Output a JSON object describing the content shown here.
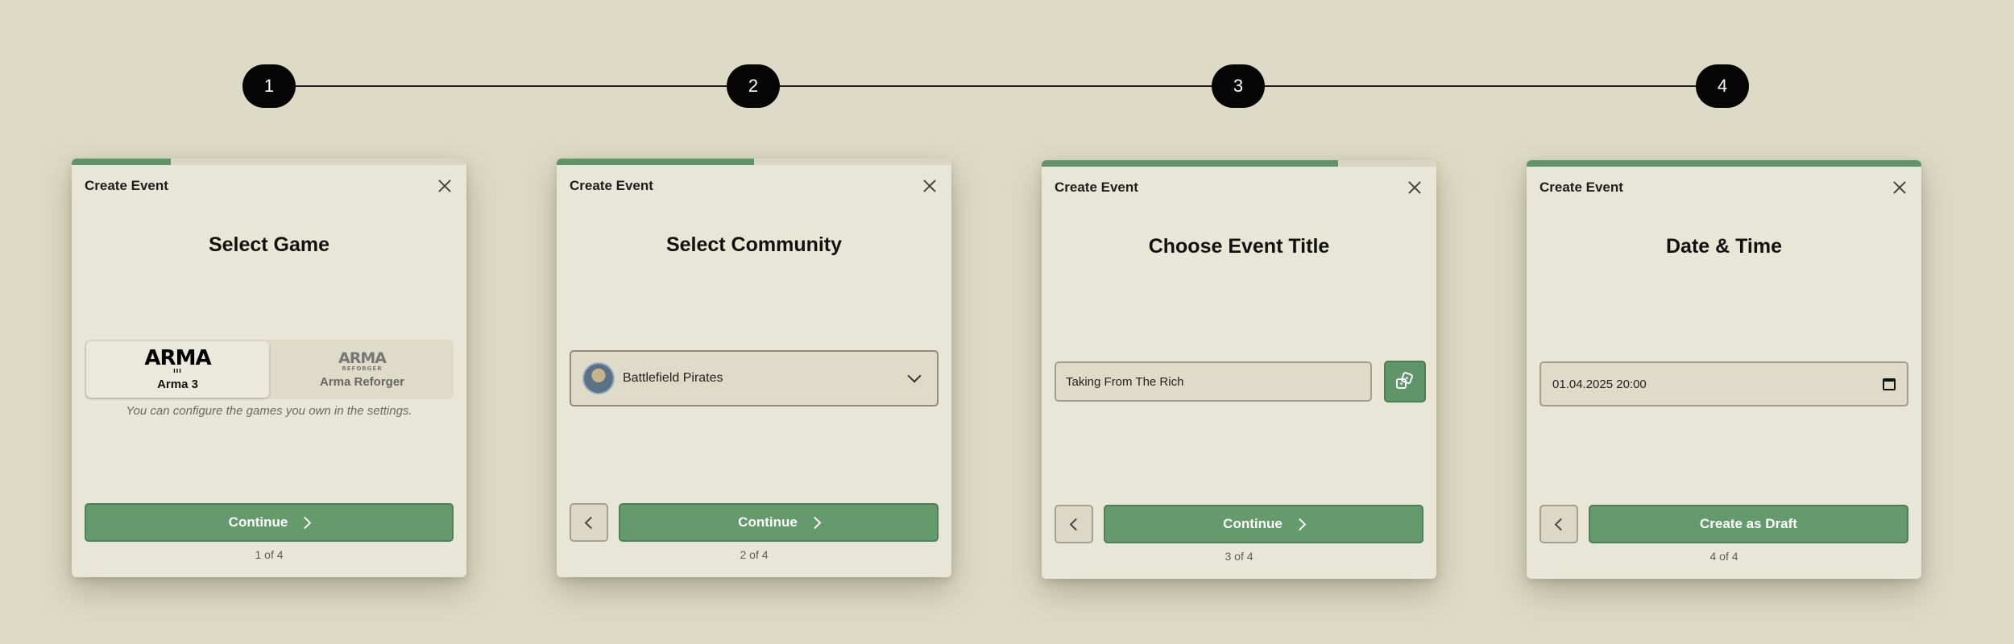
{
  "stepper": {
    "steps": [
      "1",
      "2",
      "3",
      "4"
    ]
  },
  "dialogs": [
    {
      "title": "Create Event",
      "progress": 0.25,
      "heading": "Select Game",
      "games": [
        {
          "logo": "ARMA",
          "logo_sub": "III",
          "label": "Arma 3",
          "selected": true
        },
        {
          "logo": "ARMA",
          "logo_sub": "REFORGER",
          "label": "Arma Reforger",
          "selected": false
        }
      ],
      "hint": "You can configure the games you own in the settings.",
      "continue_label": "Continue",
      "step_count": "1 of 4"
    },
    {
      "title": "Create Event",
      "progress": 0.5,
      "heading": "Select Community",
      "community": "Battlefield Pirates",
      "continue_label": "Continue",
      "step_count": "2 of 4"
    },
    {
      "title": "Create Event",
      "progress": 0.75,
      "heading": "Choose Event Title",
      "event_title_value": "Taking From The Rich",
      "continue_label": "Continue",
      "step_count": "3 of 4"
    },
    {
      "title": "Create Event",
      "progress": 1.0,
      "heading": "Date & Time",
      "datetime_value": "01.04.2025 20:00",
      "create_label": "Create as Draft",
      "step_count": "4 of 4"
    }
  ],
  "colors": {
    "background": "#dddbc5",
    "dialog": "#e8e6d6",
    "accent_green": "#5f9568",
    "step_circle": "#050505"
  },
  "icons": {
    "close": "close-icon",
    "chevron_right": "chevron-right-icon",
    "chevron_left": "chevron-left-icon",
    "chevron_down": "chevron-down-icon",
    "dice": "dice-icon",
    "calendar": "calendar-icon"
  }
}
